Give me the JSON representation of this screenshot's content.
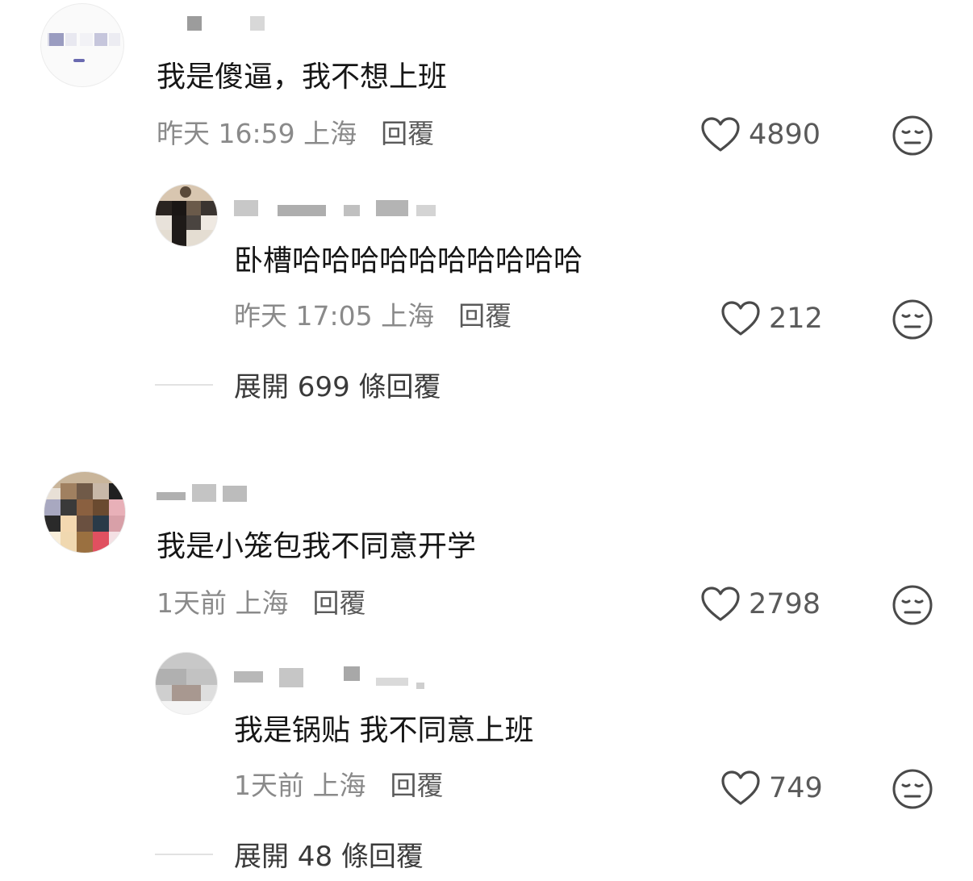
{
  "comments": [
    {
      "text": "我是傻逼，我不想上班",
      "time": "昨天 16:59 上海",
      "reply_label": "回覆",
      "likes": "4890",
      "reply": {
        "text": "卧槽哈哈哈哈哈哈哈哈哈哈",
        "time": "昨天 17:05 上海",
        "reply_label": "回覆",
        "likes": "212"
      },
      "expand": "展開 699 條回覆"
    },
    {
      "text": "我是小笼包我不同意开学",
      "time": "1天前 上海",
      "reply_label": "回覆",
      "likes": "2798",
      "reply": {
        "text": "我是锅贴 我不同意上班",
        "time": "1天前 上海",
        "reply_label": "回覆",
        "likes": "749"
      },
      "expand": "展開 48 條回覆"
    }
  ],
  "icons": {
    "like": "heart-icon",
    "dislike": "unamused-face-icon"
  },
  "colors": {
    "text": "#161616",
    "meta": "#8a8a8a",
    "icon": "#4a4a4a"
  }
}
